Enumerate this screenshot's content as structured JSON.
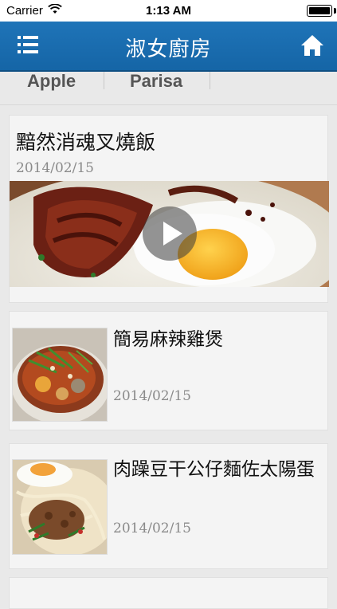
{
  "status_bar": {
    "carrier": "Carrier",
    "time": "1:13 AM"
  },
  "nav": {
    "title": "淑女廚房",
    "menu_icon": "list-menu-icon",
    "home_icon": "home-icon"
  },
  "tabs": [
    "Apple",
    "Parisa"
  ],
  "featured": {
    "title": "黯然消魂叉燒飯",
    "date": "2014/02/15",
    "image": "char-siu-rice-photo",
    "play_icon": "play-icon"
  },
  "items": [
    {
      "title": "簡易麻辣雞煲",
      "date": "2014/02/15",
      "image": "spicy-chicken-pot-photo"
    },
    {
      "title": "肉躁豆干公仔麵佐太陽蛋",
      "date": "2014/02/15",
      "image": "minced-pork-noodles-photo"
    }
  ],
  "colors": {
    "nav_bar": "#1f74b8",
    "background": "#e9e9e9",
    "card": "#f4f4f4",
    "date_text": "#8a8a8a"
  }
}
